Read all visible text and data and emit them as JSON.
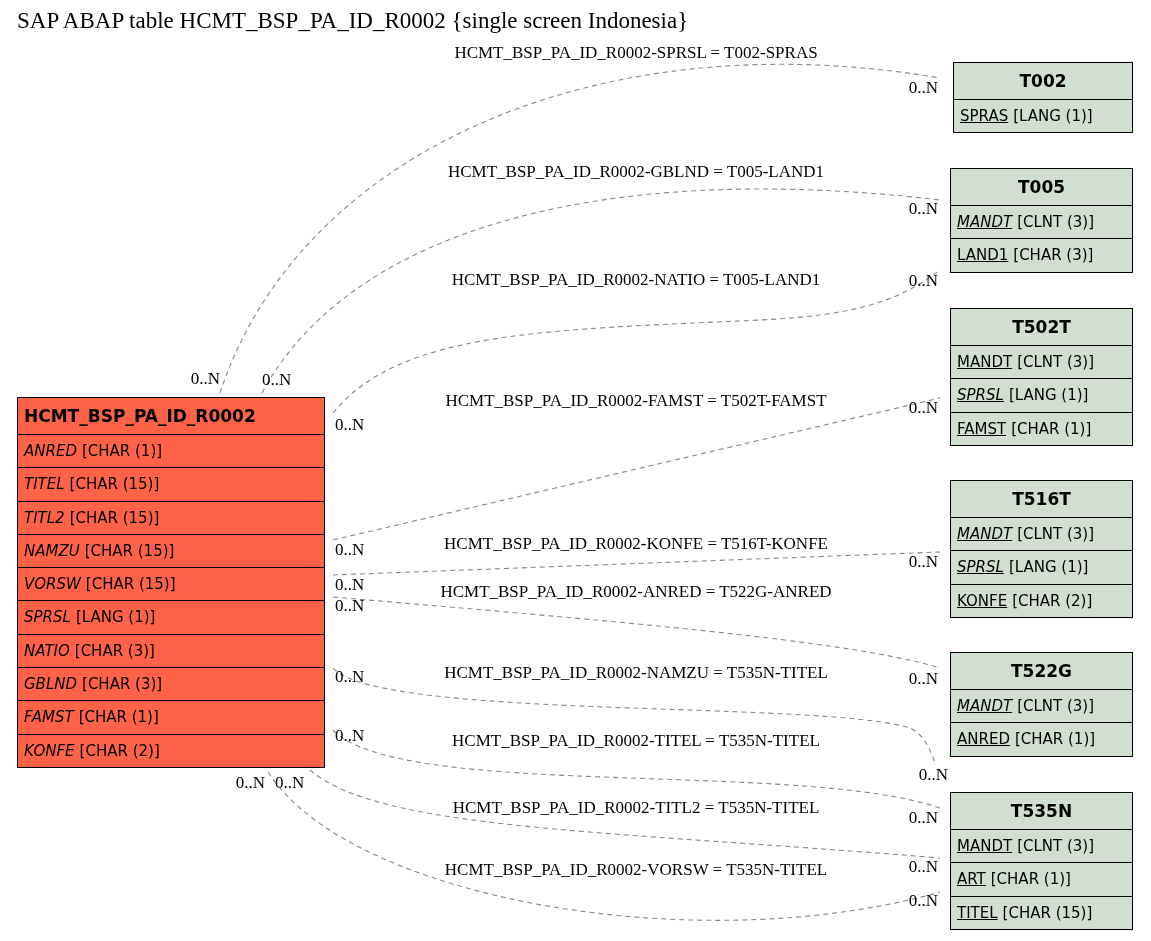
{
  "title": "SAP ABAP table HCMT_BSP_PA_ID_R0002 {single screen Indonesia}",
  "main_table": {
    "name": "HCMT_BSP_PA_ID_R0002",
    "fields": [
      {
        "name": "ANRED",
        "type": "[CHAR (1)]",
        "italic": true,
        "key": false
      },
      {
        "name": "TITEL",
        "type": "[CHAR (15)]",
        "italic": true,
        "key": false
      },
      {
        "name": "TITL2",
        "type": "[CHAR (15)]",
        "italic": true,
        "key": false
      },
      {
        "name": "NAMZU",
        "type": "[CHAR (15)]",
        "italic": true,
        "key": false
      },
      {
        "name": "VORSW",
        "type": "[CHAR (15)]",
        "italic": true,
        "key": false
      },
      {
        "name": "SPRSL",
        "type": "[LANG (1)]",
        "italic": true,
        "key": false
      },
      {
        "name": "NATIO",
        "type": "[CHAR (3)]",
        "italic": true,
        "key": false
      },
      {
        "name": "GBLND",
        "type": "[CHAR (3)]",
        "italic": true,
        "key": false
      },
      {
        "name": "FAMST",
        "type": "[CHAR (1)]",
        "italic": true,
        "key": false
      },
      {
        "name": "KONFE",
        "type": "[CHAR (2)]",
        "italic": true,
        "key": false
      }
    ]
  },
  "related_tables": [
    {
      "name": "T002",
      "fields": [
        {
          "name": "SPRAS",
          "type": "[LANG (1)]",
          "italic": false,
          "key": true
        }
      ]
    },
    {
      "name": "T005",
      "fields": [
        {
          "name": "MANDT",
          "type": "[CLNT (3)]",
          "italic": true,
          "key": true
        },
        {
          "name": "LAND1",
          "type": "[CHAR (3)]",
          "italic": false,
          "key": true
        }
      ]
    },
    {
      "name": "T502T",
      "fields": [
        {
          "name": "MANDT",
          "type": "[CLNT (3)]",
          "italic": false,
          "key": true
        },
        {
          "name": "SPRSL",
          "type": "[LANG (1)]",
          "italic": true,
          "key": true
        },
        {
          "name": "FAMST",
          "type": "[CHAR (1)]",
          "italic": false,
          "key": true
        }
      ]
    },
    {
      "name": "T516T",
      "fields": [
        {
          "name": "MANDT",
          "type": "[CLNT (3)]",
          "italic": true,
          "key": true
        },
        {
          "name": "SPRSL",
          "type": "[LANG (1)]",
          "italic": true,
          "key": true
        },
        {
          "name": "KONFE",
          "type": "[CHAR (2)]",
          "italic": false,
          "key": true
        }
      ]
    },
    {
      "name": "T522G",
      "fields": [
        {
          "name": "MANDT",
          "type": "[CLNT (3)]",
          "italic": true,
          "key": true
        },
        {
          "name": "ANRED",
          "type": "[CHAR (1)]",
          "italic": false,
          "key": true
        }
      ]
    },
    {
      "name": "T535N",
      "fields": [
        {
          "name": "MANDT",
          "type": "[CLNT (3)]",
          "italic": false,
          "key": true
        },
        {
          "name": "ART",
          "type": "[CHAR (1)]",
          "italic": false,
          "key": true
        },
        {
          "name": "TITEL",
          "type": "[CHAR (15)]",
          "italic": false,
          "key": true
        }
      ]
    }
  ],
  "relations": [
    {
      "label": "HCMT_BSP_PA_ID_R0002-SPRSL = T002-SPRAS",
      "from_cardinality": "0..N",
      "to_cardinality": "0..N"
    },
    {
      "label": "HCMT_BSP_PA_ID_R0002-GBLND = T005-LAND1",
      "from_cardinality": "0..N",
      "to_cardinality": "0..N"
    },
    {
      "label": "HCMT_BSP_PA_ID_R0002-NATIO = T005-LAND1",
      "from_cardinality": "0..N",
      "to_cardinality": "0..N"
    },
    {
      "label": "HCMT_BSP_PA_ID_R0002-FAMST = T502T-FAMST",
      "from_cardinality": "0..N",
      "to_cardinality": "0..N"
    },
    {
      "label": "HCMT_BSP_PA_ID_R0002-KONFE = T516T-KONFE",
      "from_cardinality": "0..N",
      "to_cardinality": "0..N"
    },
    {
      "label": "HCMT_BSP_PA_ID_R0002-ANRED = T522G-ANRED",
      "from_cardinality": "0..N",
      "to_cardinality": "0..N"
    },
    {
      "label": "HCMT_BSP_PA_ID_R0002-NAMZU = T535N-TITEL",
      "from_cardinality": "0..N",
      "to_cardinality": "0..N"
    },
    {
      "label": "HCMT_BSP_PA_ID_R0002-TITEL = T535N-TITEL",
      "from_cardinality": "0..N",
      "to_cardinality": "0..N"
    },
    {
      "label": "HCMT_BSP_PA_ID_R0002-TITL2 = T535N-TITEL",
      "from_cardinality": "0..N",
      "to_cardinality": "0..N"
    },
    {
      "label": "HCMT_BSP_PA_ID_R0002-VORSW = T535N-TITEL",
      "from_cardinality": "0..N",
      "to_cardinality": "0..N"
    }
  ]
}
